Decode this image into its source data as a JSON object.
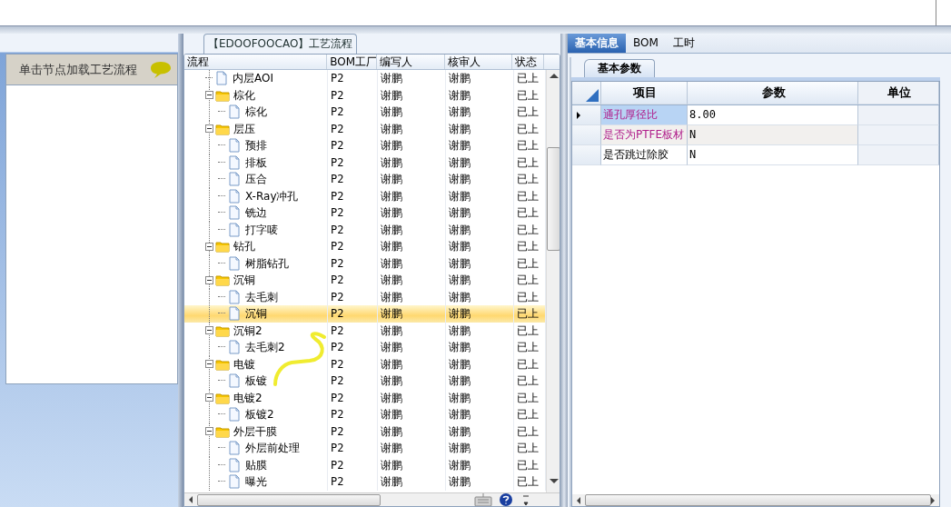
{
  "process_panel": {
    "hint": "单击节点加载工艺流程"
  },
  "process_tree": {
    "title": "【EDOOFOOCAO】工艺流程",
    "columns": [
      "流程",
      "BOM工厂",
      "编写人",
      "核审人",
      "状态"
    ],
    "nodes": [
      {
        "kind": "file",
        "name": "内层AOI",
        "factory": "P2",
        "writer": "谢鹏",
        "reviewer": "谢鹏",
        "status": "已上",
        "selected": false
      },
      {
        "kind": "folder",
        "name": "棕化",
        "factory": "P2",
        "writer": "谢鹏",
        "reviewer": "谢鹏",
        "status": "已上",
        "selected": false,
        "expanded": true,
        "children": [
          {
            "kind": "file",
            "name": "棕化",
            "factory": "P2",
            "writer": "谢鹏",
            "reviewer": "谢鹏",
            "status": "已上",
            "selected": false
          }
        ]
      },
      {
        "kind": "folder",
        "name": "层压",
        "factory": "P2",
        "writer": "谢鹏",
        "reviewer": "谢鹏",
        "status": "已上",
        "selected": false,
        "expanded": true,
        "children": [
          {
            "kind": "file",
            "name": "预排",
            "factory": "P2",
            "writer": "谢鹏",
            "reviewer": "谢鹏",
            "status": "已上",
            "selected": false
          },
          {
            "kind": "file",
            "name": "排板",
            "factory": "P2",
            "writer": "谢鹏",
            "reviewer": "谢鹏",
            "status": "已上",
            "selected": false
          },
          {
            "kind": "file",
            "name": "压合",
            "factory": "P2",
            "writer": "谢鹏",
            "reviewer": "谢鹏",
            "status": "已上",
            "selected": false
          },
          {
            "kind": "file",
            "name": "X-Ray冲孔",
            "factory": "P2",
            "writer": "谢鹏",
            "reviewer": "谢鹏",
            "status": "已上",
            "selected": false
          },
          {
            "kind": "file",
            "name": "铣边",
            "factory": "P2",
            "writer": "谢鹏",
            "reviewer": "谢鹏",
            "status": "已上",
            "selected": false
          },
          {
            "kind": "file",
            "name": "打字唛",
            "factory": "P2",
            "writer": "谢鹏",
            "reviewer": "谢鹏",
            "status": "已上",
            "selected": false
          }
        ]
      },
      {
        "kind": "folder",
        "name": "钻孔",
        "factory": "P2",
        "writer": "谢鹏",
        "reviewer": "谢鹏",
        "status": "已上",
        "selected": false,
        "expanded": true,
        "children": [
          {
            "kind": "file",
            "name": "树脂钻孔",
            "factory": "P2",
            "writer": "谢鹏",
            "reviewer": "谢鹏",
            "status": "已上",
            "selected": false
          }
        ]
      },
      {
        "kind": "folder",
        "name": "沉铜",
        "factory": "P2",
        "writer": "谢鹏",
        "reviewer": "谢鹏",
        "status": "已上",
        "selected": false,
        "expanded": true,
        "children": [
          {
            "kind": "file",
            "name": "去毛刺",
            "factory": "P2",
            "writer": "谢鹏",
            "reviewer": "谢鹏",
            "status": "已上",
            "selected": false
          },
          {
            "kind": "file",
            "name": "沉铜",
            "factory": "P2",
            "writer": "谢鹏",
            "reviewer": "谢鹏",
            "status": "已上",
            "selected": true
          }
        ]
      },
      {
        "kind": "folder",
        "name": "沉铜2",
        "factory": "P2",
        "writer": "谢鹏",
        "reviewer": "谢鹏",
        "status": "已上",
        "selected": false,
        "expanded": true,
        "children": [
          {
            "kind": "file",
            "name": "去毛刺2",
            "factory": "P2",
            "writer": "谢鹏",
            "reviewer": "谢鹏",
            "status": "已上",
            "selected": false
          }
        ]
      },
      {
        "kind": "folder",
        "name": "电镀",
        "factory": "P2",
        "writer": "谢鹏",
        "reviewer": "谢鹏",
        "status": "已上",
        "selected": false,
        "expanded": true,
        "children": [
          {
            "kind": "file",
            "name": "板镀",
            "factory": "P2",
            "writer": "谢鹏",
            "reviewer": "谢鹏",
            "status": "已上",
            "selected": false
          }
        ]
      },
      {
        "kind": "folder",
        "name": "电镀2",
        "factory": "P2",
        "writer": "谢鹏",
        "reviewer": "谢鹏",
        "status": "已上",
        "selected": false,
        "expanded": true,
        "children": [
          {
            "kind": "file",
            "name": "板镀2",
            "factory": "P2",
            "writer": "谢鹏",
            "reviewer": "谢鹏",
            "status": "已上",
            "selected": false
          }
        ]
      },
      {
        "kind": "folder",
        "name": "外层干膜",
        "factory": "P2",
        "writer": "谢鹏",
        "reviewer": "谢鹏",
        "status": "已上",
        "selected": false,
        "expanded": true,
        "children": [
          {
            "kind": "file",
            "name": "外层前处理",
            "factory": "P2",
            "writer": "谢鹏",
            "reviewer": "谢鹏",
            "status": "已上",
            "selected": false
          },
          {
            "kind": "file",
            "name": "贴膜",
            "factory": "P2",
            "writer": "谢鹏",
            "reviewer": "谢鹏",
            "status": "已上",
            "selected": false
          },
          {
            "kind": "file",
            "name": "曝光",
            "factory": "P2",
            "writer": "谢鹏",
            "reviewer": "谢鹏",
            "status": "已上",
            "selected": false
          }
        ]
      }
    ]
  },
  "detail": {
    "tabs": [
      {
        "label": "基本信息",
        "selected": true
      },
      {
        "label": "BOM",
        "selected": false
      },
      {
        "label": "工时",
        "selected": false
      }
    ],
    "subtabs": [
      {
        "label": "基本参数",
        "selected": true
      }
    ],
    "grid": {
      "columns": [
        "项目",
        "参数",
        "单位"
      ],
      "rows": [
        {
          "item": "通孔厚径比",
          "value": "8.00",
          "highlighted": true,
          "selected": true
        },
        {
          "item": "是否为PTFE板材",
          "value": "N",
          "highlighted": true,
          "selected": false
        },
        {
          "item": "是否跳过除胶",
          "value": "N",
          "highlighted": false,
          "selected": false
        }
      ]
    }
  }
}
